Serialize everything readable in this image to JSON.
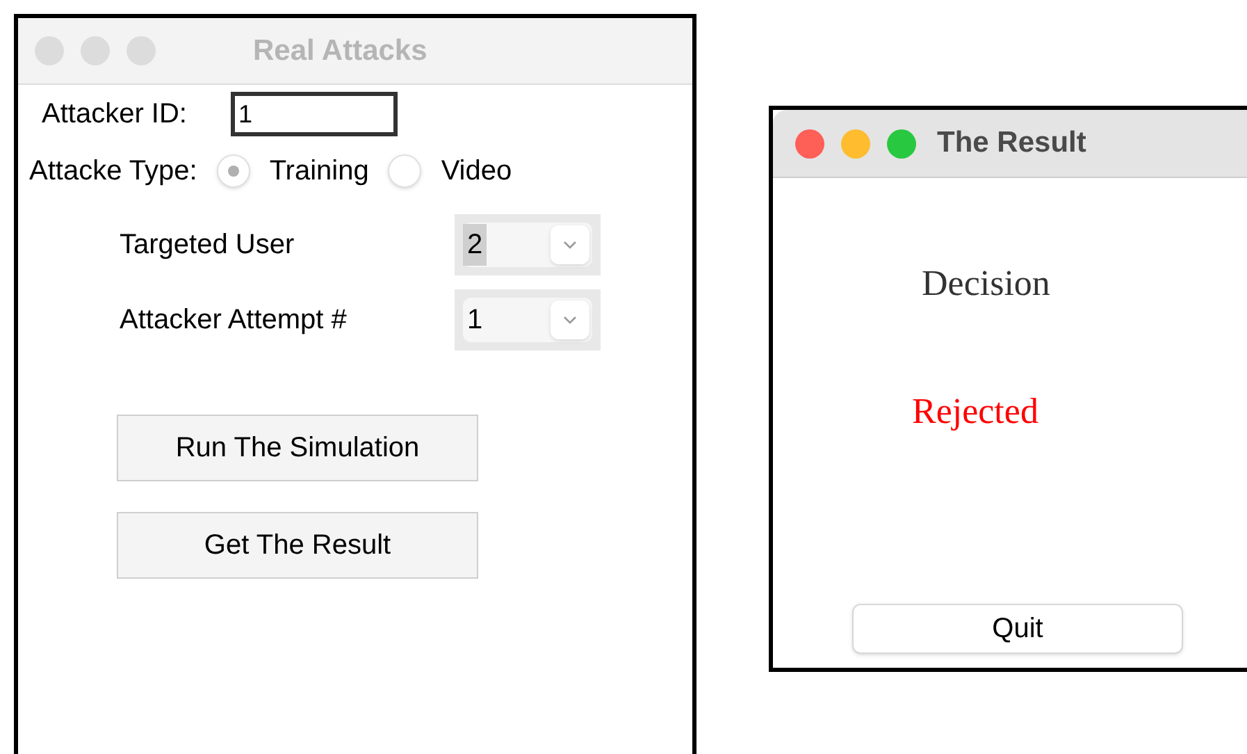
{
  "windows": [
    {
      "kind": "form",
      "title": "Real Attacks",
      "active": false,
      "attacker_id": {
        "label": "Attacker ID:",
        "value": "1"
      },
      "attack_type": {
        "label": "Attacke Type:",
        "options": [
          {
            "label": "Training",
            "selected": true
          },
          {
            "label": "Video",
            "selected": false
          }
        ]
      },
      "selects": [
        {
          "label": "Targeted User",
          "value": "2",
          "highlighted": true
        },
        {
          "label": "Attacker Attempt #",
          "value": "1",
          "highlighted": false
        }
      ],
      "buttons": [
        "Run The Simulation",
        "Get The Result"
      ]
    },
    {
      "kind": "result",
      "title": "The Result",
      "active": true,
      "heading": "Decision",
      "decision": {
        "text": "Rejected",
        "kind": "rejected"
      },
      "buttons": [
        "Quit"
      ]
    }
  ]
}
